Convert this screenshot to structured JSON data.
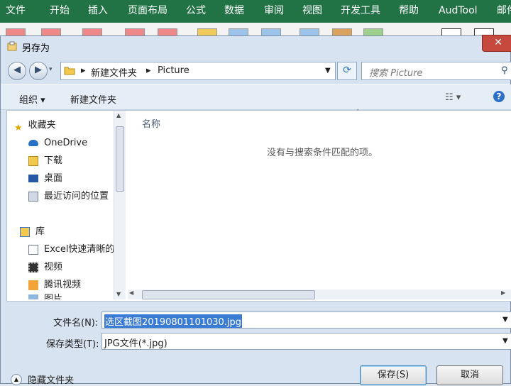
{
  "ribbon": {
    "tabs": [
      "文件",
      "开始",
      "插入",
      "页面布局",
      "公式",
      "数据",
      "审阅",
      "视图",
      "开发工具",
      "帮助",
      "AudTool",
      "邮件"
    ]
  },
  "dialog": {
    "title": "另存为",
    "close_label": "✕",
    "address": {
      "segments": [
        "新建文件夹",
        "Picture"
      ]
    },
    "search_placeholder": "搜索 Picture",
    "toolbar": {
      "organize": "组织 ▾",
      "new_folder": "新建文件夹"
    },
    "nav": {
      "items": [
        {
          "label": "收藏夹",
          "icon": "star-icon"
        },
        {
          "label": "OneDrive",
          "icon": "cloud-icon"
        },
        {
          "label": "下载",
          "icon": "download-folder-icon"
        },
        {
          "label": "桌面",
          "icon": "desktop-icon"
        },
        {
          "label": "最近访问的位置",
          "icon": "recent-places-icon"
        },
        {
          "label": "库",
          "icon": "library-icon"
        },
        {
          "label": "Excel快速清晰的",
          "icon": "document-icon"
        },
        {
          "label": "视频",
          "icon": "video-icon"
        },
        {
          "label": "腾讯视频",
          "icon": "folder-icon"
        },
        {
          "label": "图片",
          "icon": "pictures-icon"
        }
      ]
    },
    "list": {
      "column_name": "名称",
      "empty_message": "没有与搜索条件匹配的项。"
    },
    "filename": {
      "label": "文件名(N):",
      "value": "选区截图20190801101030.jpg"
    },
    "filetype": {
      "label": "保存类型(T):",
      "value": "JPG文件(*.jpg)"
    },
    "hide_folders": "隐藏文件夹",
    "save_button": "保存(S)",
    "cancel_button": "取消"
  }
}
